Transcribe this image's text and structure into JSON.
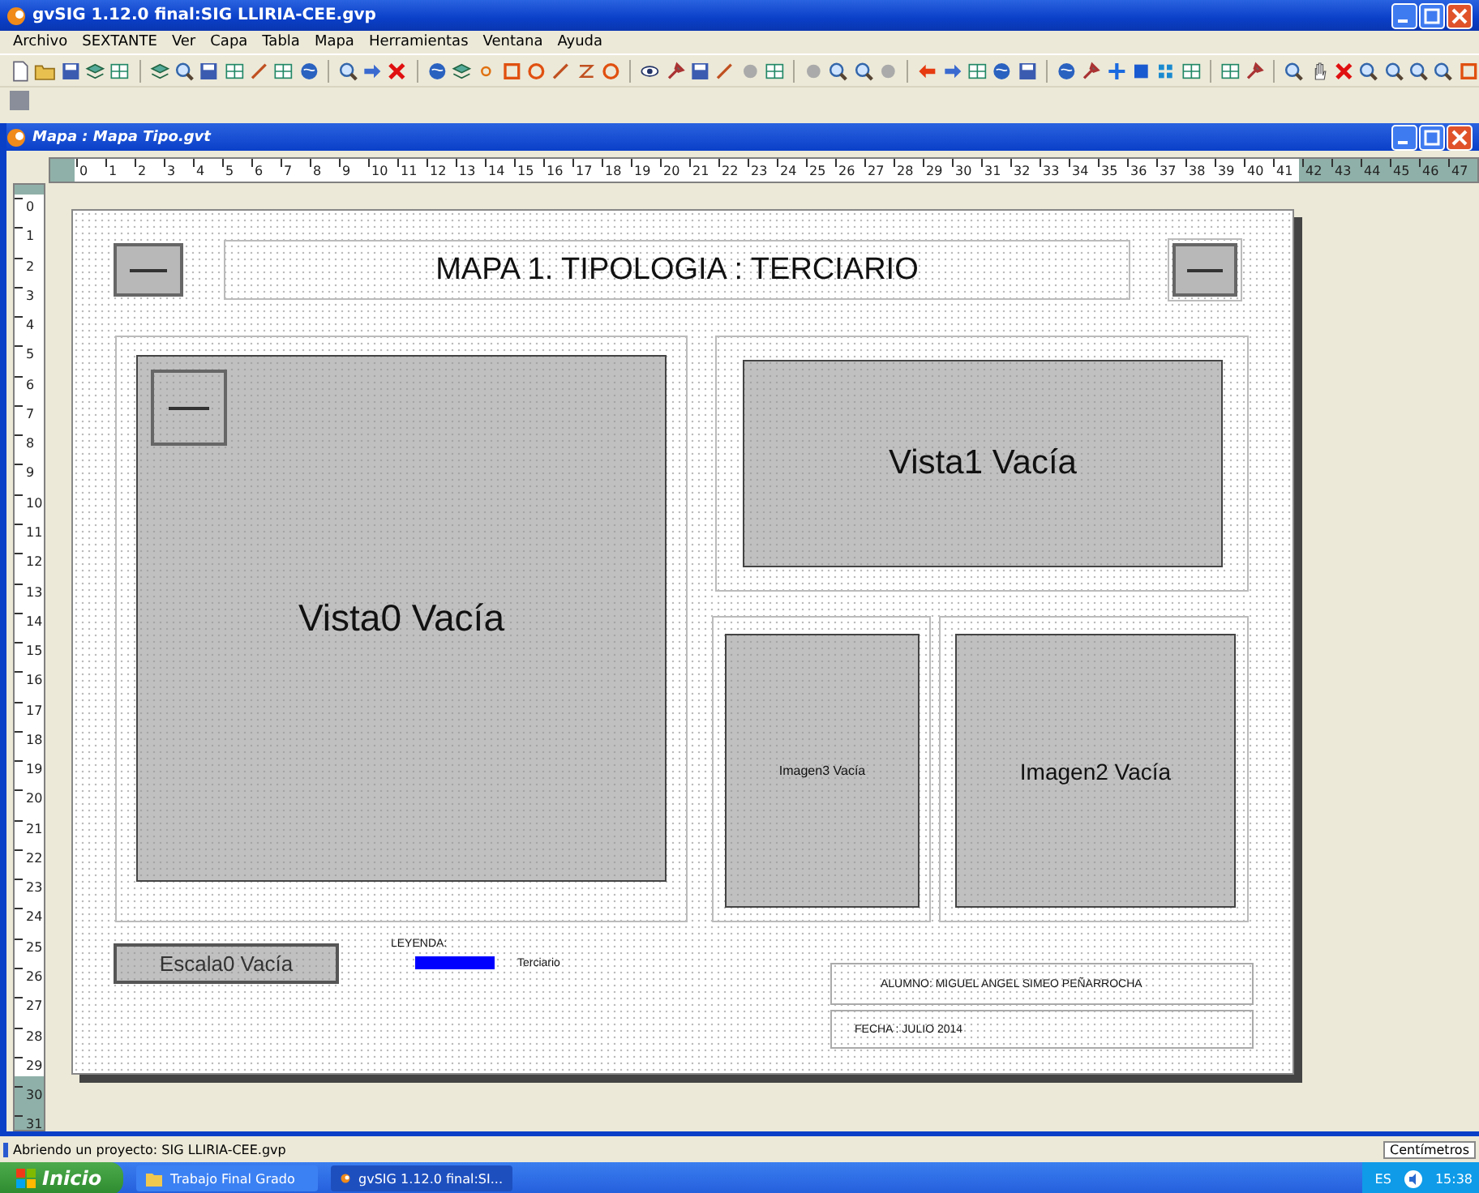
{
  "app_window": {
    "title": "gvSIG 1.12.0 final:SIG LLIRIA-CEE.gvp"
  },
  "menu": [
    "Archivo",
    "SEXTANTE",
    "Ver",
    "Capa",
    "Tabla",
    "Mapa",
    "Herramientas",
    "Ventana",
    "Ayuda"
  ],
  "map_window": {
    "title": "Mapa : Mapa Tipo.gvt"
  },
  "rulers": {
    "horizontal": [
      "0",
      "1",
      "2",
      "3",
      "4",
      "5",
      "6",
      "7",
      "8",
      "9",
      "10",
      "11",
      "12",
      "13",
      "14",
      "15",
      "16",
      "17",
      "18",
      "19",
      "20",
      "21",
      "22",
      "23",
      "24",
      "25",
      "26",
      "27",
      "28",
      "29",
      "30",
      "31",
      "32",
      "33",
      "34",
      "35",
      "36",
      "37",
      "38",
      "39",
      "40",
      "41",
      "42",
      "43",
      "44",
      "45",
      "46",
      "47"
    ],
    "vertical": [
      "0",
      "1",
      "2",
      "3",
      "4",
      "5",
      "6",
      "7",
      "8",
      "9",
      "10",
      "11",
      "12",
      "13",
      "14",
      "15",
      "16",
      "17",
      "18",
      "19",
      "20",
      "21",
      "22",
      "23",
      "24",
      "25",
      "26",
      "27",
      "28",
      "29",
      "30",
      "31"
    ]
  },
  "layout": {
    "frames": [
      {
        "kind": "picture-box"
      },
      {
        "kind": "title",
        "text": "MAPA 1. TIPOLOGIA : TERCIARIO"
      },
      {
        "kind": "picture-box"
      },
      {
        "kind": "view",
        "text": "Vista0 Vacía"
      },
      {
        "kind": "picture-box"
      },
      {
        "kind": "view",
        "text": "Vista1 Vacía"
      },
      {
        "kind": "image",
        "text": "Imagen3 Vacía"
      },
      {
        "kind": "image",
        "text": "Imagen2 Vacía"
      },
      {
        "kind": "scale",
        "text": "Escala0 Vacía"
      },
      {
        "kind": "legend",
        "title": "LEYENDA:",
        "items": [
          {
            "label": "Terciario",
            "color": "#0000ff"
          }
        ]
      },
      {
        "kind": "text",
        "text": "ALUMNO: MIGUEL ANGEL SIMEO PEÑARROCHA"
      },
      {
        "kind": "text",
        "text": "FECHA : JULIO 2014"
      }
    ]
  },
  "status_bar": {
    "message": "Abriendo un proyecto: SIG LLIRIA-CEE.gvp",
    "units": "Centímetros"
  },
  "taskbar": {
    "start": "Inicio",
    "tasks": [
      {
        "label": "Trabajo Final Grado",
        "selected": false
      },
      {
        "label": "gvSIG 1.12.0 final:SI...",
        "selected": true
      }
    ],
    "language": "ES",
    "clock": "15:38"
  }
}
